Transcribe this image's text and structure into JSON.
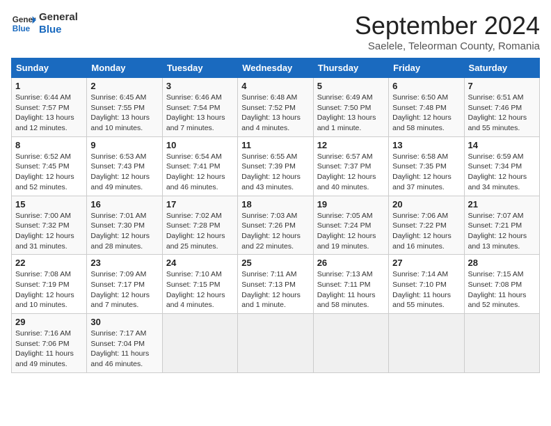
{
  "header": {
    "logo_general": "General",
    "logo_blue": "Blue",
    "title": "September 2024",
    "subtitle": "Saelele, Teleorman County, Romania"
  },
  "days_of_week": [
    "Sunday",
    "Monday",
    "Tuesday",
    "Wednesday",
    "Thursday",
    "Friday",
    "Saturday"
  ],
  "weeks": [
    [
      {
        "day": "1",
        "info": "Sunrise: 6:44 AM\nSunset: 7:57 PM\nDaylight: 13 hours\nand 12 minutes."
      },
      {
        "day": "2",
        "info": "Sunrise: 6:45 AM\nSunset: 7:55 PM\nDaylight: 13 hours\nand 10 minutes."
      },
      {
        "day": "3",
        "info": "Sunrise: 6:46 AM\nSunset: 7:54 PM\nDaylight: 13 hours\nand 7 minutes."
      },
      {
        "day": "4",
        "info": "Sunrise: 6:48 AM\nSunset: 7:52 PM\nDaylight: 13 hours\nand 4 minutes."
      },
      {
        "day": "5",
        "info": "Sunrise: 6:49 AM\nSunset: 7:50 PM\nDaylight: 13 hours\nand 1 minute."
      },
      {
        "day": "6",
        "info": "Sunrise: 6:50 AM\nSunset: 7:48 PM\nDaylight: 12 hours\nand 58 minutes."
      },
      {
        "day": "7",
        "info": "Sunrise: 6:51 AM\nSunset: 7:46 PM\nDaylight: 12 hours\nand 55 minutes."
      }
    ],
    [
      {
        "day": "8",
        "info": "Sunrise: 6:52 AM\nSunset: 7:45 PM\nDaylight: 12 hours\nand 52 minutes."
      },
      {
        "day": "9",
        "info": "Sunrise: 6:53 AM\nSunset: 7:43 PM\nDaylight: 12 hours\nand 49 minutes."
      },
      {
        "day": "10",
        "info": "Sunrise: 6:54 AM\nSunset: 7:41 PM\nDaylight: 12 hours\nand 46 minutes."
      },
      {
        "day": "11",
        "info": "Sunrise: 6:55 AM\nSunset: 7:39 PM\nDaylight: 12 hours\nand 43 minutes."
      },
      {
        "day": "12",
        "info": "Sunrise: 6:57 AM\nSunset: 7:37 PM\nDaylight: 12 hours\nand 40 minutes."
      },
      {
        "day": "13",
        "info": "Sunrise: 6:58 AM\nSunset: 7:35 PM\nDaylight: 12 hours\nand 37 minutes."
      },
      {
        "day": "14",
        "info": "Sunrise: 6:59 AM\nSunset: 7:34 PM\nDaylight: 12 hours\nand 34 minutes."
      }
    ],
    [
      {
        "day": "15",
        "info": "Sunrise: 7:00 AM\nSunset: 7:32 PM\nDaylight: 12 hours\nand 31 minutes."
      },
      {
        "day": "16",
        "info": "Sunrise: 7:01 AM\nSunset: 7:30 PM\nDaylight: 12 hours\nand 28 minutes."
      },
      {
        "day": "17",
        "info": "Sunrise: 7:02 AM\nSunset: 7:28 PM\nDaylight: 12 hours\nand 25 minutes."
      },
      {
        "day": "18",
        "info": "Sunrise: 7:03 AM\nSunset: 7:26 PM\nDaylight: 12 hours\nand 22 minutes."
      },
      {
        "day": "19",
        "info": "Sunrise: 7:05 AM\nSunset: 7:24 PM\nDaylight: 12 hours\nand 19 minutes."
      },
      {
        "day": "20",
        "info": "Sunrise: 7:06 AM\nSunset: 7:22 PM\nDaylight: 12 hours\nand 16 minutes."
      },
      {
        "day": "21",
        "info": "Sunrise: 7:07 AM\nSunset: 7:21 PM\nDaylight: 12 hours\nand 13 minutes."
      }
    ],
    [
      {
        "day": "22",
        "info": "Sunrise: 7:08 AM\nSunset: 7:19 PM\nDaylight: 12 hours\nand 10 minutes."
      },
      {
        "day": "23",
        "info": "Sunrise: 7:09 AM\nSunset: 7:17 PM\nDaylight: 12 hours\nand 7 minutes."
      },
      {
        "day": "24",
        "info": "Sunrise: 7:10 AM\nSunset: 7:15 PM\nDaylight: 12 hours\nand 4 minutes."
      },
      {
        "day": "25",
        "info": "Sunrise: 7:11 AM\nSunset: 7:13 PM\nDaylight: 12 hours\nand 1 minute."
      },
      {
        "day": "26",
        "info": "Sunrise: 7:13 AM\nSunset: 7:11 PM\nDaylight: 11 hours\nand 58 minutes."
      },
      {
        "day": "27",
        "info": "Sunrise: 7:14 AM\nSunset: 7:10 PM\nDaylight: 11 hours\nand 55 minutes."
      },
      {
        "day": "28",
        "info": "Sunrise: 7:15 AM\nSunset: 7:08 PM\nDaylight: 11 hours\nand 52 minutes."
      }
    ],
    [
      {
        "day": "29",
        "info": "Sunrise: 7:16 AM\nSunset: 7:06 PM\nDaylight: 11 hours\nand 49 minutes."
      },
      {
        "day": "30",
        "info": "Sunrise: 7:17 AM\nSunset: 7:04 PM\nDaylight: 11 hours\nand 46 minutes."
      },
      {
        "day": "",
        "info": ""
      },
      {
        "day": "",
        "info": ""
      },
      {
        "day": "",
        "info": ""
      },
      {
        "day": "",
        "info": ""
      },
      {
        "day": "",
        "info": ""
      }
    ]
  ]
}
